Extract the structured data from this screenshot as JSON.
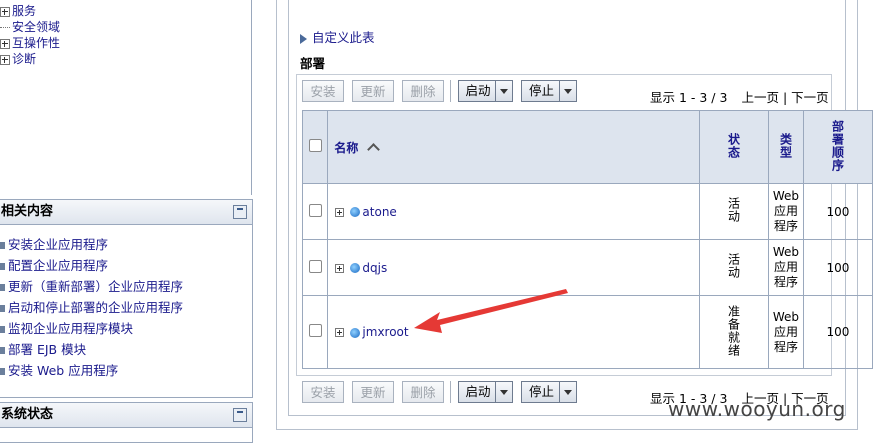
{
  "left_tree": {
    "items": [
      {
        "label": "服务",
        "expandable": true
      },
      {
        "label": "安全领域",
        "expandable": false
      },
      {
        "label": "互操作性",
        "expandable": true
      },
      {
        "label": "诊断",
        "expandable": true
      }
    ]
  },
  "related": {
    "title": "相关内容",
    "links": [
      "安装企业应用程序",
      "配置企业应用程序",
      "更新（重新部署）企业应用程序",
      "启动和停止部署的企业应用程序",
      "监视企业应用程序模块",
      "部署 EJB 模块",
      "安装 Web 应用程序"
    ]
  },
  "system_status": {
    "title": "系统状态"
  },
  "customize_link": "自定义此表",
  "section_title": "部署",
  "toolbar": {
    "install": "安装",
    "update": "更新",
    "delete": "删除",
    "start": "启动",
    "stop": "停止"
  },
  "pager": {
    "display": "显示 1 - 3 / 3",
    "prev": "上一页",
    "separator": "|",
    "next": "下一页"
  },
  "table": {
    "headers": {
      "name": "名称",
      "state": "状态",
      "type": "类型",
      "order": "部署顺序"
    },
    "rows": [
      {
        "name": "atone",
        "state": "活动",
        "type": "Web 应用程序",
        "order": "100"
      },
      {
        "name": "dqjs",
        "state": "活动",
        "type": "Web 应用程序",
        "order": "100"
      },
      {
        "name": "jmxroot",
        "state": "准备就绪",
        "type": "Web 应用程序",
        "order": "100"
      }
    ]
  },
  "watermark": "www.wooyun.org"
}
